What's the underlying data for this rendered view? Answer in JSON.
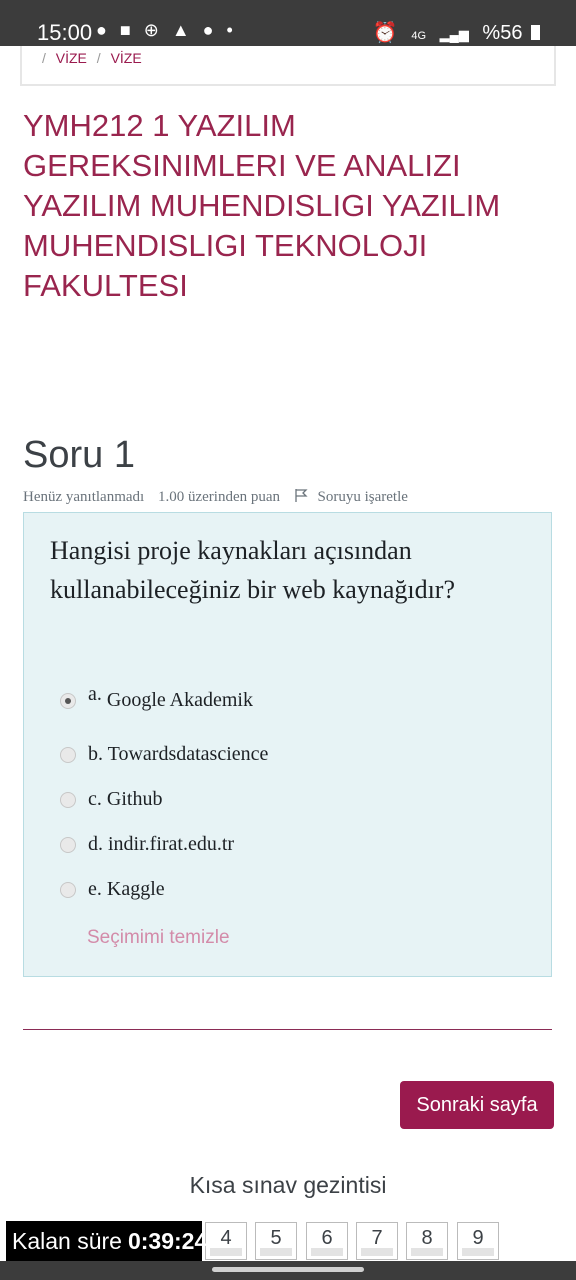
{
  "status": {
    "time": "15:00",
    "left_icons": "● ■ ⊕ ▲ ● •",
    "alarm": "⏰",
    "net": "4G",
    "signal": "▂▄▆",
    "battery": "%56"
  },
  "breadcrumb": {
    "item1": "VİZE",
    "item2": "VİZE"
  },
  "course_title": "YMH212 1 YAZILIM GEREKSINIMLERI VE ANALIZI YAZILIM MUHENDISLIGI YAZILIM MUHENDISLIGI TEKNOLOJI FAKULTESI",
  "question": {
    "title": "Soru 1",
    "state": "Henüz yanıtlanmadı",
    "grade": "1.00 üzerinden puan",
    "flag_label": "Soruyu işaretle",
    "text": "Hangisi proje kaynakları açısından kullanabileceğiniz bir web kaynağıdır?",
    "answers": [
      {
        "letter": "a.",
        "label": "Google Akademik",
        "checked": true
      },
      {
        "letter": "b.",
        "label": "Towardsdatascience",
        "checked": false
      },
      {
        "letter": "c.",
        "label": "Github",
        "checked": false
      },
      {
        "letter": "d.",
        "label": "indir.firat.edu.tr",
        "checked": false
      },
      {
        "letter": "e.",
        "label": "Kaggle",
        "checked": false
      }
    ],
    "clear_label": "Seçimimi temizle"
  },
  "next_button": "Sonraki sayfa",
  "quiz_nav_title": "Kısa sınav gezintisi",
  "timer": {
    "label": "Kalan süre",
    "value": "0:39:24"
  },
  "quiz_nav_numbers": [
    "4",
    "5",
    "6",
    "7",
    "8",
    "9"
  ]
}
